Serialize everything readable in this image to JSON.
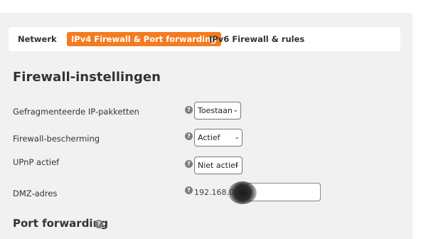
{
  "tabs": {
    "netwerk": "Netwerk",
    "ipv4": "IPv4 Firewall & Port forwarding",
    "ipv6": "IPv6 Firewall & rules"
  },
  "firewall_section": {
    "title": "Firewall-instellingen",
    "rows": {
      "fragmented": {
        "label": "Gefragmenteerde IP-pakketten",
        "value": "Toestaan"
      },
      "protection": {
        "label": "Firewall-bescherming",
        "value": "Actief"
      },
      "upnp": {
        "label": "UPnP actief",
        "value": "Niet actief"
      },
      "dmz": {
        "label": "DMZ-adres",
        "prefix": "192.168.0."
      }
    }
  },
  "port_forwarding": {
    "title": "Port forwarding"
  },
  "help_glyph": "?",
  "dropdown_glyph": "⌄",
  "colors": {
    "accent": "#f47b20",
    "panel": "#f1f1f1",
    "help": "#7d7d7d"
  },
  "icons": {
    "help": "question-circle-icon",
    "dropdown": "chevron-down-icon"
  }
}
